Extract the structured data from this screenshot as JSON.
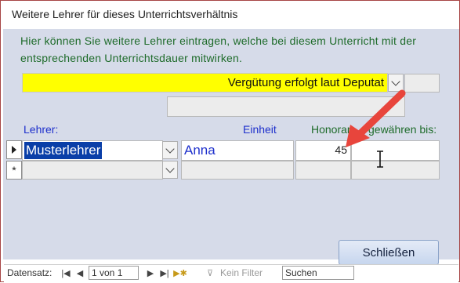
{
  "window": {
    "title": "Weitere Lehrer für dieses Unterrichtsverhältnis"
  },
  "hint": "Hier können Sie weitere Lehrer eintragen, welche bei diesem Unterricht mit der entsprechenden Unterrichtsdauer mitwirken.",
  "verguetung": {
    "value": "Vergütung erfolgt laut Deputat"
  },
  "headers": {
    "lehrer": "Lehrer:",
    "einheit": "Einheit",
    "honorar": "Honorar",
    "gewaehren": "gewähren bis:"
  },
  "rows": [
    {
      "selector": "current",
      "lehrer": "Musterlehrer",
      "einheit": "Anna",
      "honorar": "45",
      "gewaehren": ""
    },
    {
      "selector": "*",
      "lehrer": "",
      "einheit": "",
      "honorar": "",
      "gewaehren": ""
    }
  ],
  "buttons": {
    "close": "Schließen"
  },
  "navigation": {
    "label": "Datensatz:",
    "record": "1 von 1",
    "filter": "Kein Filter",
    "search": "Suchen"
  },
  "colors": {
    "accent_yellow": "#ffff00",
    "form_background": "#d6dbe9",
    "hint_green": "#1e6b2a",
    "header_blue": "#1d2fcc",
    "selection_blue": "#0a3fa8",
    "annotation_red": "#e8453c"
  },
  "icons": {
    "record_selector_current": "triangle-right-icon",
    "record_selector_new": "asterisk-icon",
    "dropdown": "chevron-down-icon",
    "nav_first": "first-record-icon",
    "nav_prev": "previous-record-icon",
    "nav_next": "next-record-icon",
    "nav_last": "last-record-icon",
    "nav_new": "new-record-icon",
    "filter": "filter-icon",
    "annotation": "red-arrow-icon",
    "cursor": "text-cursor-icon"
  }
}
